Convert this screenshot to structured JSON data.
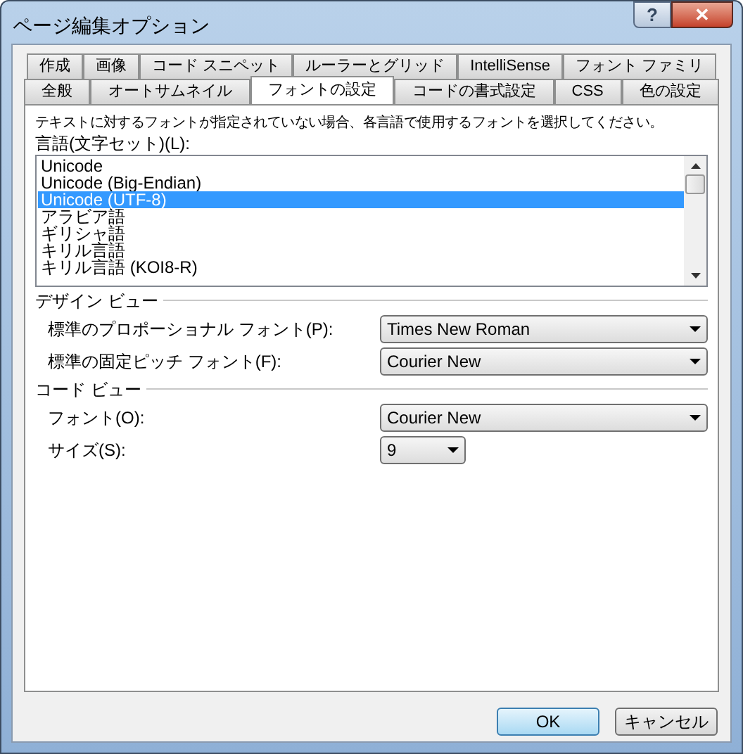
{
  "window": {
    "title": "ページ編集オプション",
    "help_button": "?",
    "close_button": "✕"
  },
  "tab_rows": [
    [
      {
        "label": "作成",
        "selected": false
      },
      {
        "label": "画像",
        "selected": false
      },
      {
        "label": "コード スニペット",
        "selected": false
      },
      {
        "label": "ルーラーとグリッド",
        "selected": false
      },
      {
        "label": "IntelliSense",
        "selected": false
      },
      {
        "label": "フォント ファミリ",
        "selected": false
      }
    ],
    [
      {
        "label": "全般",
        "selected": false
      },
      {
        "label": "オートサムネイル",
        "selected": false
      },
      {
        "label": "フォントの設定",
        "selected": true
      },
      {
        "label": "コードの書式設定",
        "selected": false
      },
      {
        "label": "CSS",
        "selected": false
      },
      {
        "label": "色の設定",
        "selected": false
      }
    ]
  ],
  "description": "テキストに対するフォントが指定されていない場合、各言語で使用するフォントを選択してください。",
  "language_label": "言語(文字セット)(L):",
  "languages": [
    {
      "label": "Unicode",
      "selected": false
    },
    {
      "label": "Unicode (Big-Endian)",
      "selected": false
    },
    {
      "label": "Unicode (UTF-8)",
      "selected": true
    },
    {
      "label": "アラビア語",
      "selected": false
    },
    {
      "label": "ギリシャ語",
      "selected": false
    },
    {
      "label": "キリル言語",
      "selected": false
    },
    {
      "label": "キリル言語 (KOI8-R)",
      "selected": false
    }
  ],
  "sections": [
    {
      "title": "デザイン ビュー",
      "rows": [
        {
          "label": "標準のプロポーショナル フォント(P):",
          "value": "Times New Roman",
          "kind": "wide"
        },
        {
          "label": "標準の固定ピッチ フォント(F):",
          "value": "Courier New",
          "kind": "wide"
        }
      ]
    },
    {
      "title": "コード ビュー",
      "rows": [
        {
          "label": "フォント(O):",
          "value": "Courier New",
          "kind": "wide"
        },
        {
          "label": "サイズ(S):",
          "value": "9",
          "kind": "narrow"
        }
      ]
    }
  ],
  "buttons": [
    {
      "label": "OK",
      "default": true
    },
    {
      "label": "キャンセル",
      "default": false
    }
  ]
}
